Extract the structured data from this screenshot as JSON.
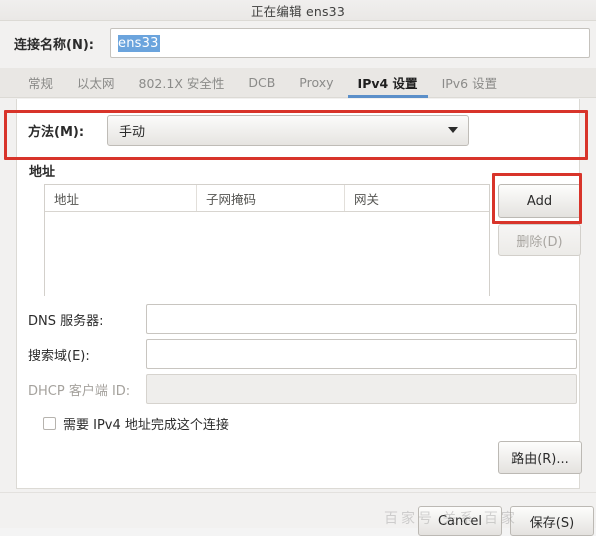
{
  "window": {
    "title": "正在编辑 ens33"
  },
  "connection": {
    "name_label": "连接名称(N):",
    "name_value": "ens33"
  },
  "tabs": [
    {
      "label": "常规",
      "active": false
    },
    {
      "label": "以太网",
      "active": false
    },
    {
      "label": "802.1X 安全性",
      "active": false
    },
    {
      "label": "DCB",
      "active": false
    },
    {
      "label": "Proxy",
      "active": false
    },
    {
      "label": "IPv4 设置",
      "active": true
    },
    {
      "label": "IPv6 设置",
      "active": false
    }
  ],
  "method": {
    "label": "方法(M):",
    "value": "手动",
    "arrow_icon": "chevron-down-icon"
  },
  "addresses": {
    "section_title": "地址",
    "columns": [
      "地址",
      "子网掩码",
      "网关"
    ],
    "rows": [],
    "add_label": "Add",
    "delete_label": "删除(D)",
    "delete_disabled": true
  },
  "fields": {
    "dns_label": "DNS 服务器:",
    "dns_value": "",
    "search_label": "搜索域(E):",
    "search_value": "",
    "dhcp_label": "DHCP 客户端 ID:",
    "dhcp_value": "",
    "dhcp_disabled": true
  },
  "require_ipv4": {
    "label": "需要 IPv4 地址完成这个连接",
    "checked": false
  },
  "routes": {
    "label": "路由(R)..."
  },
  "footer": {
    "cancel_label": "Cancel",
    "save_label": "保存(S)"
  },
  "watermark": {
    "text": "百家号 关系 百家"
  },
  "colors": {
    "accent": "#5b8fc9",
    "selection": "#6ba4dd",
    "annotation": "#d8342a",
    "panel_bg": "#ffffff",
    "dialog_bg": "#f2f1f0"
  }
}
